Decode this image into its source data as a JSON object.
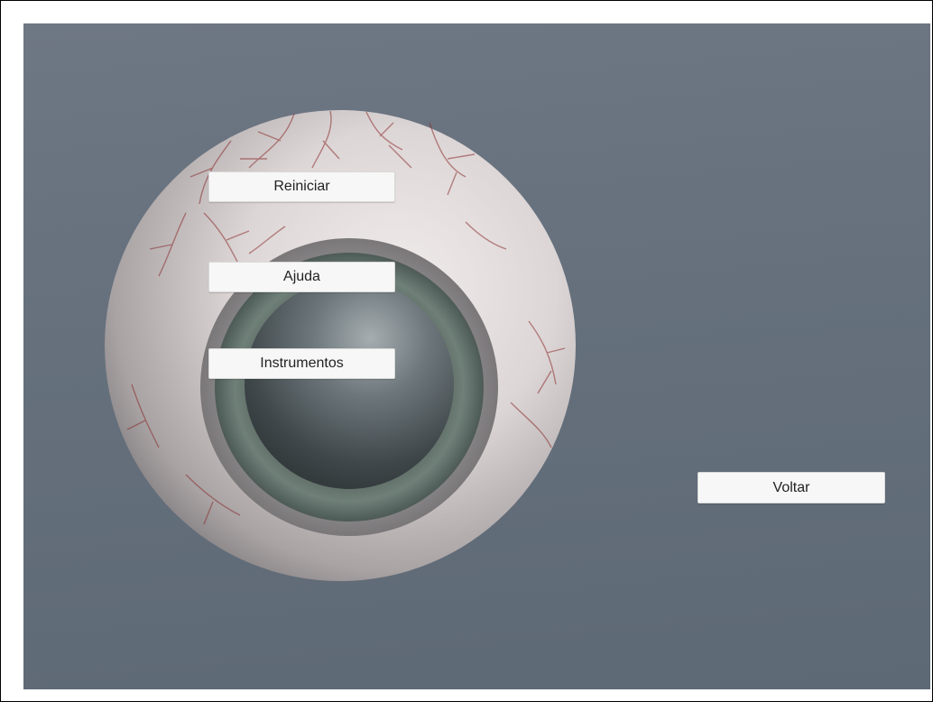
{
  "scene": {
    "object": "eyeball-model",
    "colors": {
      "background": "#65707c",
      "sclera": "#d9d2d2",
      "iris": "#6b7d76",
      "pupil": "#3d4548",
      "vessels": "#8a2e2e"
    }
  },
  "menu": {
    "reiniciar_label": "Reiniciar",
    "ajuda_label": "Ajuda",
    "instrumentos_label": "Instrumentos",
    "voltar_label": "Voltar"
  }
}
